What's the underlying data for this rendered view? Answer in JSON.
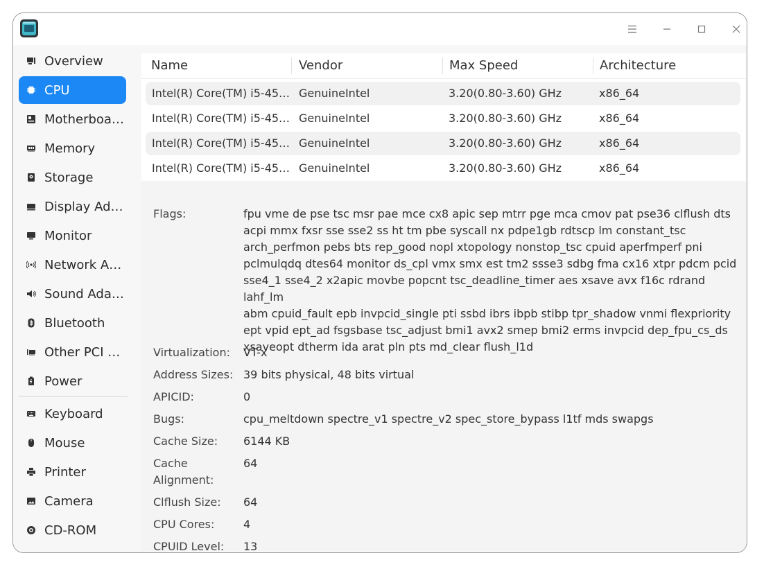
{
  "sidebar": {
    "items": [
      {
        "label": "Overview",
        "icon": "overview-icon"
      },
      {
        "label": "CPU",
        "icon": "cpu-icon",
        "active": true
      },
      {
        "label": "Motherboa…",
        "icon": "motherboard-icon"
      },
      {
        "label": "Memory",
        "icon": "memory-icon"
      },
      {
        "label": "Storage",
        "icon": "storage-icon"
      },
      {
        "label": "Display Ad…",
        "icon": "display-adapter-icon"
      },
      {
        "label": "Monitor",
        "icon": "monitor-icon"
      },
      {
        "label": "Network A…",
        "icon": "network-icon"
      },
      {
        "label": "Sound Ada…",
        "icon": "sound-icon"
      },
      {
        "label": "Bluetooth",
        "icon": "bluetooth-icon"
      },
      {
        "label": "Other PCI …",
        "icon": "pci-icon"
      },
      {
        "label": "Power",
        "icon": "power-icon"
      },
      {
        "label": "Keyboard",
        "icon": "keyboard-icon"
      },
      {
        "label": "Mouse",
        "icon": "mouse-icon"
      },
      {
        "label": "Printer",
        "icon": "printer-icon"
      },
      {
        "label": "Camera",
        "icon": "camera-icon"
      },
      {
        "label": "CD-ROM",
        "icon": "cdrom-icon"
      }
    ]
  },
  "table": {
    "headers": [
      "Name",
      "Vendor",
      "Max Speed",
      "Architecture"
    ],
    "rows": [
      [
        "Intel(R) Core(TM) i5-45…",
        "GenuineIntel",
        "3.20(0.80-3.60) GHz",
        "x86_64"
      ],
      [
        "Intel(R) Core(TM) i5-45…",
        "GenuineIntel",
        "3.20(0.80-3.60) GHz",
        "x86_64"
      ],
      [
        "Intel(R) Core(TM) i5-45…",
        "GenuineIntel",
        "3.20(0.80-3.60) GHz",
        "x86_64"
      ],
      [
        "Intel(R) Core(TM) i5-45…",
        "GenuineIntel",
        "3.20(0.80-3.60) GHz",
        "x86_64"
      ]
    ]
  },
  "details": {
    "flags_label": "Flags:",
    "flags_lines": [
      "fpu vme de pse tsc msr pae mce cx8 apic sep mtrr pge mca cmov pat pse36 clflush dts",
      "acpi mmx fxsr sse sse2 ss ht tm pbe syscall nx pdpe1gb rdtscp lm constant_tsc",
      "arch_perfmon pebs bts rep_good nopl xtopology nonstop_tsc cpuid aperfmperf pni",
      "pclmulqdq dtes64 monitor ds_cpl vmx smx est tm2 ssse3 sdbg fma cx16 xtpr pdcm pcid",
      "sse4_1 sse4_2 x2apic movbe popcnt tsc_deadline_timer aes xsave avx f16c rdrand lahf_lm",
      "abm cpuid_fault epb invpcid_single pti ssbd ibrs ibpb stibp tpr_shadow vnmi flexpriority",
      "ept vpid ept_ad fsgsbase tsc_adjust bmi1 avx2 smep bmi2 erms invpcid dep_fpu_cs_ds",
      "xsaveopt dtherm ida arat pln pts md_clear flush_l1d"
    ],
    "pairs": [
      {
        "label": "Virtualization:",
        "value": "VT-x"
      },
      {
        "label": "Address Sizes:",
        "value": "39 bits physical, 48 bits virtual"
      },
      {
        "label": "APICID:",
        "value": "0"
      },
      {
        "label": "Bugs:",
        "value": "cpu_meltdown spectre_v1 spectre_v2 spec_store_bypass l1tf mds swapgs"
      },
      {
        "label": "Cache Size:",
        "value": "6144 KB"
      },
      {
        "label": "Cache Alignment:",
        "value": "64"
      },
      {
        "label": "Clflush Size:",
        "value": "64"
      },
      {
        "label": "CPU Cores:",
        "value": "4"
      },
      {
        "label": "CPUID Level:",
        "value": "13"
      }
    ]
  },
  "colors": {
    "accent": "#1b88f5"
  }
}
